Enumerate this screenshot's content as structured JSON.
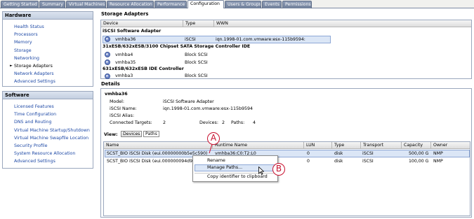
{
  "tabs": [
    "Getting Started",
    "Summary",
    "Virtual Machines",
    "Resource Allocation",
    "Performance",
    "Configuration",
    "Users & Groups",
    "Events",
    "Permissions"
  ],
  "active_tab": "Configuration",
  "hardware": {
    "title": "Hardware",
    "items": [
      "Health Status",
      "Processors",
      "Memory",
      "Storage",
      "Networking",
      "Storage Adapters",
      "Network Adapters",
      "Advanced Settings"
    ],
    "selected": "Storage Adapters"
  },
  "software": {
    "title": "Software",
    "items": [
      "Licensed Features",
      "Time Configuration",
      "DNS and Routing",
      "Virtual Machine Startup/Shutdown",
      "Virtual Machine Swapfile Location",
      "Security Profile",
      "System Resource Allocation",
      "Advanced Settings"
    ]
  },
  "storage_adapters": {
    "title": "Storage Adapters",
    "columns": [
      "Device",
      "Type",
      "WWN"
    ],
    "groups": [
      {
        "name": "iSCSI Software Adapter",
        "rows": [
          {
            "device": "vmhba36",
            "type": "iSCSI",
            "wwn": "iqn.1998-01.com.vmware:esx-115b9594:"
          }
        ]
      },
      {
        "name": "31xESB/632xESB/3100 Chipset SATA Storage Controller IDE",
        "rows": [
          {
            "device": "vmhba4",
            "type": "Block SCSI",
            "wwn": ""
          },
          {
            "device": "vmhba35",
            "type": "Block SCSI",
            "wwn": ""
          }
        ]
      },
      {
        "name": "631xESB/632xESB IDE Controller",
        "rows": [
          {
            "device": "vmhba3",
            "type": "Block SCSI",
            "wwn": ""
          }
        ]
      }
    ]
  },
  "details": {
    "title": "Details",
    "adapter": "vmhba36",
    "model_label": "Model:",
    "model": "iSCSI Software Adapter",
    "iscsi_name_label": "iSCSI Name:",
    "iscsi_name": "iqn.1998-01.com.vmware:esx-115b9594",
    "iscsi_alias_label": "iSCSI Alias:",
    "iscsi_alias": "",
    "connected_targets_label": "Connected Targets:",
    "connected_targets": "2",
    "devices_label": "Devices:",
    "devices": "2",
    "paths_label": "Paths:",
    "paths": "4",
    "view_label": "View:",
    "view_buttons": [
      "Devices",
      "Paths"
    ],
    "columns": [
      "Name",
      "Runtime Name",
      "LUN",
      "Type",
      "Transport",
      "Capacity",
      "Owner"
    ],
    "rows": [
      {
        "name": "SCST_BIO iSCSI Disk (eui.00000000b5e5c590)",
        "runtime": "vmhba36:C0:T2:L0",
        "lun": "0",
        "type": "disk",
        "transport": "iSCSI",
        "capacity": "500,00 G",
        "owner": "NMP"
      },
      {
        "name": "SCST_BIO iSCSI Disk (eui.000000094d9a",
        "runtime": "",
        "lun": "0",
        "type": "disk",
        "transport": "iSCSI",
        "capacity": "100,00 G",
        "owner": "NMP"
      }
    ]
  },
  "context_menu": {
    "items": [
      "Rename",
      "Manage Paths...",
      "Copy identifier to clipboard"
    ],
    "highlighted": "Manage Paths..."
  },
  "callouts": [
    "A",
    "B"
  ],
  "colors": {
    "link": "#1f4aa6",
    "selection": "#dbe6f6",
    "callout": "#c8102e",
    "tab": "#7c8aa3"
  }
}
